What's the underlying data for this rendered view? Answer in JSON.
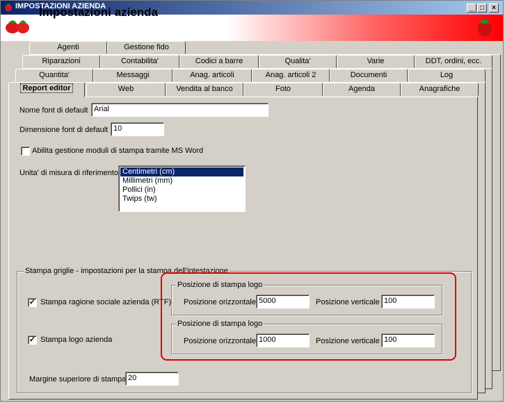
{
  "window": {
    "title": "IMPOSTAZIONI AZIENDA",
    "minimize": "_",
    "maximize": "□",
    "close": "×"
  },
  "header": {
    "title": "Impostazioni azienda"
  },
  "tabs": {
    "row1": [
      "Agenti",
      "Gestione fido"
    ],
    "row2": [
      "Riparazioni",
      "Contabilita'",
      "Codici a barre",
      "Qualita'",
      "Varie",
      "DDT, ordini, ecc."
    ],
    "row3": [
      "Quantita'",
      "Messaggi",
      "Anag. articoli",
      "Anag. articoli 2",
      "Documenti",
      "Log"
    ],
    "row4": [
      "Report editor",
      "Web",
      "Vendita al banco",
      "Foto",
      "Agenda",
      "Anagrafiche"
    ]
  },
  "form": {
    "font_label": "Nome font di default",
    "font_value": "Arial",
    "size_label": "Dimensione font di default",
    "size_value": "10",
    "word_label": "Abilita gestione moduli di stampa tramite MS Word",
    "word_checked": "",
    "unit_label": "Unita' di misura di riferimento",
    "units": [
      "Centimetri (cm)",
      "Millimetri (mm)",
      "Pollici (in)",
      "Twips (tw)"
    ]
  },
  "grid": {
    "legend": "Stampa griglie - impostazioni per la stampa dell'intestazione",
    "ragione_label": "Stampa ragione sociale azienda (RTF)",
    "ragione_checked": "✓",
    "logo_label": "Stampa logo azienda",
    "logo_checked": "✓",
    "group1": {
      "legend": "Posizione di stampa logo",
      "h_label": "Posizione orizzontale",
      "h_value": "5000",
      "v_label": "Posizione verticale",
      "v_value": "100"
    },
    "group2": {
      "legend": "Posizione di stampa logo",
      "h_label": "Posizione orizzontale",
      "h_value": "1000",
      "v_label": "Posizione verticale",
      "v_value": "100"
    },
    "margin_label": "Margine superiore di stampa",
    "margin_value": "20"
  },
  "colors": {
    "titlebar": "#0a246a",
    "highlight": "#e00000",
    "selection": "#0a246a"
  },
  "icons": {
    "app": "strawberry-icon",
    "header": "strawberry-icon"
  }
}
